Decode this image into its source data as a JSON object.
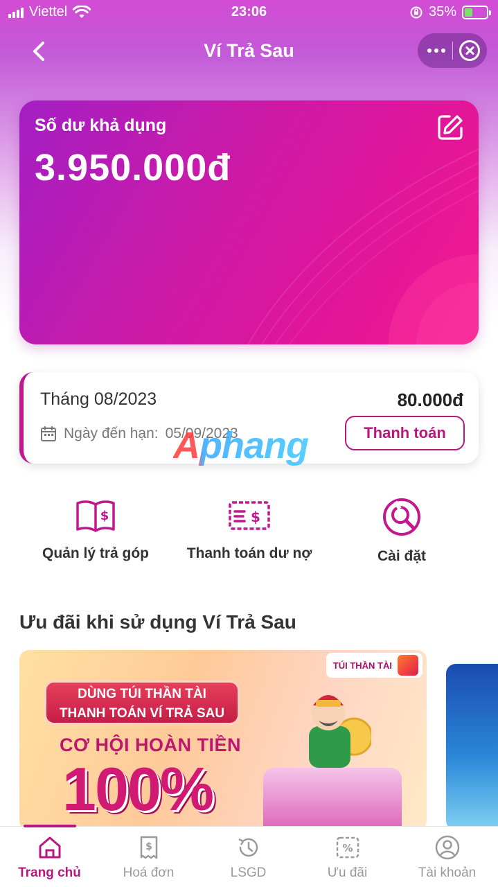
{
  "status_bar": {
    "carrier": "Viettel",
    "time": "23:06",
    "battery_percent": "35%",
    "battery_level": 0.35
  },
  "nav": {
    "title": "Ví Trả Sau",
    "back_icon": "chevron-left-icon",
    "more_icon": "more-dots-icon",
    "close_icon": "close-circle-icon"
  },
  "balance": {
    "label": "Số dư khả dụng",
    "amount": "3.950.000đ"
  },
  "bill": {
    "month": "Tháng 08/2023",
    "amount": "80.000đ",
    "due_label": "Ngày đến hạn:",
    "due_date": "05/09/2023",
    "pay_button": "Thanh toán"
  },
  "watermark": "Aphang",
  "actions": [
    {
      "label": "Quản lý trả góp",
      "icon": "installment-book-icon"
    },
    {
      "label": "Thanh toán dư nợ",
      "icon": "debt-payment-icon"
    },
    {
      "label": "Cài đặt",
      "icon": "settings-wrench-icon"
    }
  ],
  "promotions": {
    "title": "Ưu đãi khi sử dụng Ví Trả Sau",
    "banner": {
      "tag": "TÚI THẦN TÀI",
      "pill_line1": "DÙNG TÚI THẦN TÀI",
      "pill_line2": "THANH TOÁN VÍ TRẢ SAU",
      "headline": "CƠ HỘI HOÀN TIỀN",
      "big": "100%"
    }
  },
  "tabs": [
    {
      "label": "Trang chủ",
      "icon": "home-icon",
      "active": true
    },
    {
      "label": "Hoá đơn",
      "icon": "bill-icon",
      "active": false
    },
    {
      "label": "LSGD",
      "icon": "history-icon",
      "active": false
    },
    {
      "label": "Ưu đãi",
      "icon": "discount-icon",
      "active": false
    },
    {
      "label": "Tài khoản",
      "icon": "account-icon",
      "active": false
    }
  ],
  "colors": {
    "brand": "#b8177f",
    "card_start": "#a31ec4",
    "card_end": "#f21a8f"
  }
}
